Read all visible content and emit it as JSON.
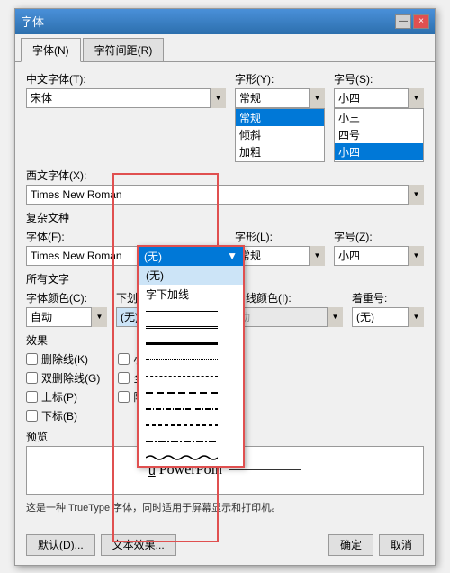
{
  "dialog": {
    "title": "字体",
    "close_btn": "×",
    "minimize_btn": "—",
    "tabs": [
      {
        "label": "字体(N)",
        "active": true
      },
      {
        "label": "字符间距(R)",
        "active": false
      }
    ]
  },
  "fields": {
    "chinese_font": {
      "label": "中文字体(T):",
      "value": "宋体"
    },
    "style": {
      "label": "字形(Y):",
      "list_items": [
        "常规",
        "倾斜",
        "加粗"
      ],
      "selected": "常规"
    },
    "size": {
      "label": "字号(S):",
      "list_items": [
        "小三",
        "四号",
        "小四"
      ],
      "selected": "小四"
    },
    "western_font": {
      "label": "西文字体(X):",
      "value": "Times New Roman"
    },
    "complex_title": "复杂文种",
    "complex_font": {
      "label": "字体(F):",
      "value": "Times New Roman"
    },
    "complex_style": {
      "label": "字形(L):",
      "value": "常规"
    },
    "complex_size": {
      "label": "字号(Z):",
      "value": "小四"
    },
    "all_text_title": "所有文字",
    "font_color": {
      "label": "字体颜色(C):",
      "value": "自动"
    },
    "underline_style": {
      "label": "下划线线型(U):",
      "value": "(无)"
    },
    "underline_color": {
      "label": "下划线颜色(I):",
      "value": "自动"
    },
    "emphasis": {
      "label": "着重号:",
      "value": "(无)"
    }
  },
  "effects": {
    "title": "效果",
    "left_col": [
      {
        "label": "删除线(K)",
        "checked": false
      },
      {
        "label": "双删除线(G)",
        "checked": false
      },
      {
        "label": "上标(P)",
        "checked": false
      },
      {
        "label": "下标(B)",
        "checked": false
      }
    ],
    "right_col": [
      {
        "label": "小型大写字母(M)",
        "checked": false
      },
      {
        "label": "全部大写字母(A)",
        "checked": false
      },
      {
        "label": "隐藏文字(H)",
        "checked": false
      }
    ]
  },
  "preview": {
    "title": "预览",
    "text": "PowerPoin",
    "underline_char": "u"
  },
  "info_text": "这是一种 TrueType 字体，同时适用于屏幕显示和打印机。",
  "buttons": {
    "default": "默认(D)...",
    "text_effect": "文本效果...",
    "ok": "确定",
    "cancel": "取消"
  },
  "dropdown": {
    "title": "(无)",
    "items": [
      {
        "label": "(无)",
        "selected": true,
        "type": "text"
      },
      {
        "label": "字下加线",
        "type": "text"
      },
      {
        "label": "single",
        "type": "line-single"
      },
      {
        "label": "double",
        "type": "line-double"
      },
      {
        "label": "thick",
        "type": "line-thick"
      },
      {
        "label": "dotted",
        "type": "line-dotted"
      },
      {
        "label": "dashed",
        "type": "line-dashed"
      },
      {
        "label": "dash-long",
        "type": "line-dash-long"
      },
      {
        "label": "dash-dot",
        "type": "line-dash-dot"
      },
      {
        "label": "dashed2",
        "type": "line-dashed2"
      },
      {
        "label": "dash-dot2",
        "type": "line-dash-dot2"
      },
      {
        "label": "wavy",
        "type": "line-wavy"
      }
    ]
  }
}
